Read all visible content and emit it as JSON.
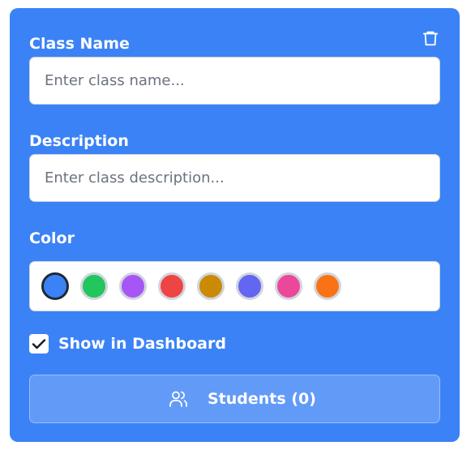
{
  "form": {
    "class_name": {
      "label": "Class Name",
      "value": "",
      "placeholder": "Enter class name..."
    },
    "description": {
      "label": "Description",
      "value": "",
      "placeholder": "Enter class description..."
    },
    "color": {
      "label": "Color",
      "selected": "#3b82f6",
      "options": [
        "#3b82f6",
        "#22c55e",
        "#a855f7",
        "#ef4444",
        "#ca8a04",
        "#6366f1",
        "#ec4899",
        "#f97316"
      ]
    },
    "show_in_dashboard": {
      "label": "Show in Dashboard",
      "checked": true
    },
    "students_button": {
      "label": "Students (0)",
      "icon": "users-icon"
    },
    "delete_icon": "trash-icon"
  },
  "colors": {
    "card_background": "#3b82f6",
    "text": "#ffffff"
  }
}
